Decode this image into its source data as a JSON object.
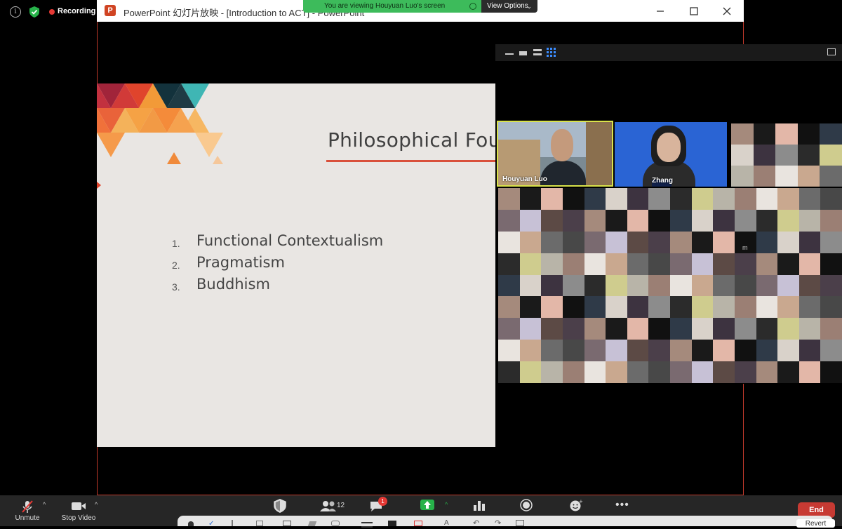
{
  "status": {
    "recording_label": "Recording"
  },
  "ppt": {
    "logo_letter": "P",
    "title": "PowerPoint 幻灯片放映 - [Introduction to ACT] - PowerPoint"
  },
  "banner": {
    "viewing_text": "You are viewing Houyuan Luo's screen",
    "view_options_label": "View Options"
  },
  "slide": {
    "title": "Philosophical Fou",
    "items": [
      {
        "num": "1.",
        "text": "Functional Contextualism"
      },
      {
        "num": "2.",
        "text": "Pragmatism"
      },
      {
        "num": "3.",
        "text": "Buddhism"
      }
    ]
  },
  "gallery": {
    "participants": [
      {
        "name": "Houyuan Luo",
        "active_speaker": true
      },
      {
        "name": "Zhang"
      },
      {
        "name": "m"
      }
    ]
  },
  "toolbar": {
    "unmute_label": "Unmute",
    "stop_video_label": "Stop Video",
    "participants_count": "12",
    "chat_badge": "1",
    "end_label": "End",
    "revert_label": "Revert"
  },
  "colors": {
    "accent_red": "#d9503b",
    "banner_green": "#3dbb5b",
    "end_red": "#c73a33",
    "share_green": "#27b24a"
  }
}
